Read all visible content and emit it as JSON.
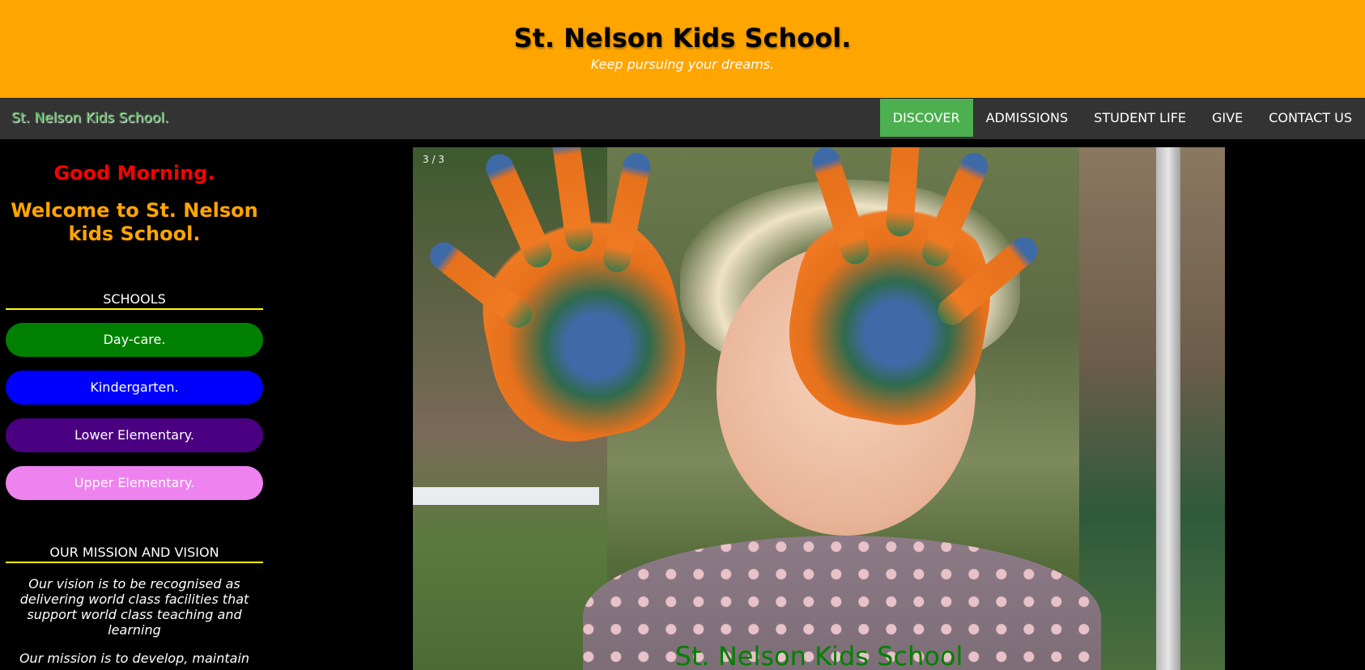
{
  "header": {
    "title": "St. Nelson Kids School.",
    "tagline": "Keep pursuing your dreams."
  },
  "nav": {
    "brand": "St. Nelson Kids School.",
    "links": [
      {
        "label": "DISCOVER",
        "active": true
      },
      {
        "label": "ADMISSIONS",
        "active": false
      },
      {
        "label": "STUDENT LIFE",
        "active": false
      },
      {
        "label": "GIVE",
        "active": false
      },
      {
        "label": "CONTACT US",
        "active": false
      }
    ],
    "active_color": "#4caf50"
  },
  "sidebar": {
    "greeting": "Good Morning.",
    "welcome": "Welcome to St. Nelson kids School.",
    "schools_heading": "SCHOOLS",
    "schools": [
      {
        "label": "Day-care.",
        "color": "#008000"
      },
      {
        "label": "Kindergarten.",
        "color": "#0000ff"
      },
      {
        "label": "Lower Elementary.",
        "color": "#4b0082"
      },
      {
        "label": "Upper Elementary.",
        "color": "#ee82ee"
      }
    ],
    "mission_heading": "OUR MISSION AND VISION",
    "vision_text": "Our vision is to be recognised as delivering world class facilities that support world class teaching and learning",
    "mission_text": "Our mission is to develop, maintain"
  },
  "slideshow": {
    "counter": "3 / 3",
    "caption": "St. Nelson Kids School"
  },
  "colors": {
    "banner": "#ffa500",
    "navbar": "#333333",
    "greeting": "#ff0000",
    "welcome": "#ffa500",
    "heading_underline": "#ffff00"
  }
}
